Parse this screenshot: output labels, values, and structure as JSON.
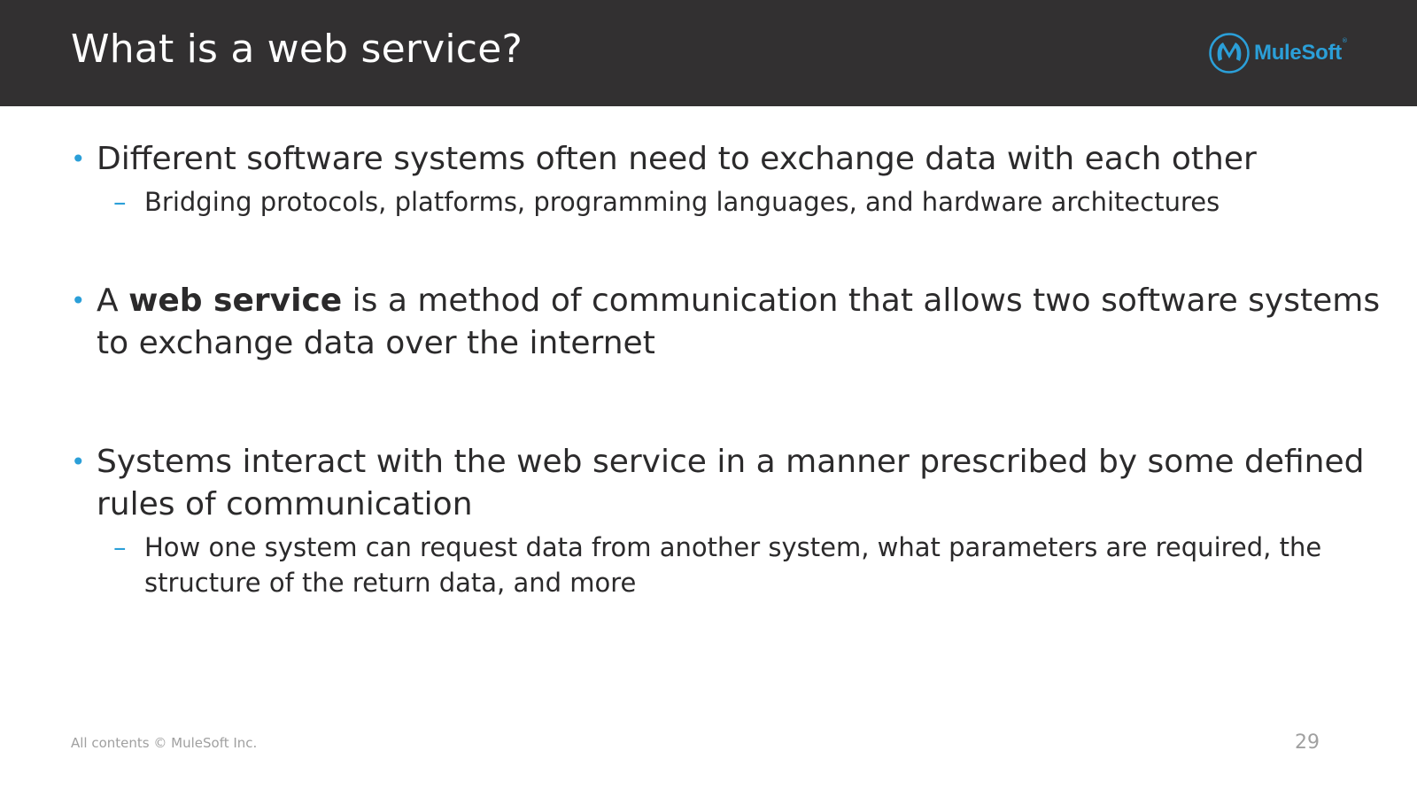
{
  "slide": {
    "title": "What is a web service?",
    "logo_text": "MuleSoft",
    "logo_tm": "®",
    "bullets": [
      {
        "text": "Different software systems often need to exchange data with each other",
        "sub": "Bridging protocols, platforms, programming languages, and hardware architectures"
      },
      {
        "pre": "A ",
        "bold": "web service",
        "post": " is a method of communication that allows two software systems to exchange data over the internet"
      },
      {
        "text": "Systems interact with the web service in a manner prescribed by some defined rules of communication",
        "sub": "How one system can request data from another system, what parameters are required, the structure of the return data, and more"
      }
    ],
    "bullet_mark": "•",
    "sub_mark": "–",
    "footer": "All contents © MuleSoft Inc.",
    "page_number": "29"
  },
  "colors": {
    "header_bg": "#323031",
    "accent": "#2b9fd8",
    "text": "#2b2a2b",
    "footer_text": "#a0a0a0"
  }
}
